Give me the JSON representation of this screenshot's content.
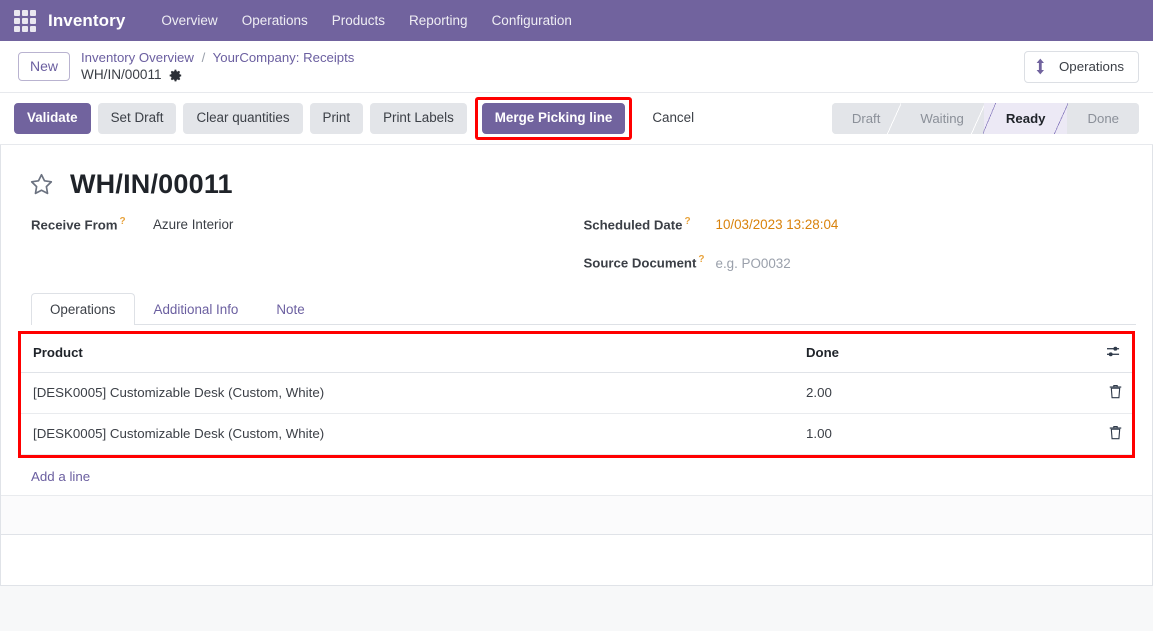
{
  "navbar": {
    "apps_icon": "apps-grid-icon",
    "brand": "Inventory",
    "menu": [
      {
        "label": "Overview"
      },
      {
        "label": "Operations"
      },
      {
        "label": "Products"
      },
      {
        "label": "Reporting"
      },
      {
        "label": "Configuration"
      }
    ]
  },
  "controlpanel": {
    "new_label": "New",
    "breadcrumb": {
      "root": "Inventory Overview",
      "separator": "/",
      "parent": "YourCompany: Receipts",
      "current": "WH/IN/00011",
      "settings_icon": "gear-icon"
    },
    "smart_button": {
      "label": "Operations",
      "icon": "exchange-vertical-icon"
    }
  },
  "actions": {
    "buttons": [
      {
        "label": "Validate",
        "style": "primary"
      },
      {
        "label": "Set Draft",
        "style": "secondary"
      },
      {
        "label": "Clear quantities",
        "style": "secondary"
      },
      {
        "label": "Print",
        "style": "secondary"
      },
      {
        "label": "Print Labels",
        "style": "secondary"
      },
      {
        "label": "Merge Picking line",
        "style": "merge-highlighted"
      },
      {
        "label": "Cancel",
        "style": "flat"
      }
    ],
    "highlight_color": "#ff0000",
    "primary_color": "#71639e"
  },
  "status": {
    "stages": [
      {
        "label": "Draft",
        "active": false
      },
      {
        "label": "Waiting",
        "active": false
      },
      {
        "label": "Ready",
        "active": true
      },
      {
        "label": "Done",
        "active": false
      }
    ]
  },
  "record": {
    "favorite_icon": "star-outline-icon",
    "title": "WH/IN/00011",
    "fields_left": [
      {
        "label": "Receive From",
        "tooltip_marker": "?",
        "value": "Azure Interior",
        "is_placeholder": false,
        "value_style": "normal"
      }
    ],
    "fields_right": [
      {
        "label": "Scheduled Date",
        "tooltip_marker": "?",
        "value": "10/03/2023 13:28:04",
        "is_placeholder": false,
        "value_style": "date"
      },
      {
        "label": "Source Document",
        "tooltip_marker": "?",
        "value": "e.g. PO0032",
        "is_placeholder": true,
        "value_style": "placeholder"
      }
    ]
  },
  "notebook": {
    "tabs": [
      {
        "label": "Operations",
        "active": true
      },
      {
        "label": "Additional Info",
        "active": false
      },
      {
        "label": "Note",
        "active": false
      }
    ]
  },
  "lines_table": {
    "columns": [
      "Product",
      "Done"
    ],
    "optional_columns_icon": "sliders-icon",
    "rows": [
      {
        "product": "[DESK0005] Customizable Desk (Custom, White)",
        "done": "2.00",
        "delete_icon": "trash-icon"
      },
      {
        "product": "[DESK0005] Customizable Desk (Custom, White)",
        "done": "1.00",
        "delete_icon": "trash-icon"
      }
    ],
    "add_line_label": "Add a line"
  }
}
